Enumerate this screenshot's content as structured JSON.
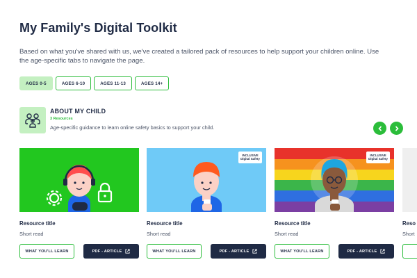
{
  "page": {
    "title": "My Family's Digital Toolkit",
    "intro": "Based on what you've shared with us, we've created a tailored pack of resources to help support your children online. Use the age-specific tabs to navigate the page."
  },
  "tabs": [
    {
      "label": "AGES 0-5"
    },
    {
      "label": "AGES 6-10"
    },
    {
      "label": "AGES 11-13"
    },
    {
      "label": "AGES 14+"
    }
  ],
  "section": {
    "title": "ABOUT MY CHILD",
    "count": "3 Resources",
    "description": "Age-specific guidance to learn online safety basics to support your child.",
    "icon": "family-icon"
  },
  "cards": [
    {
      "title": "Resource title",
      "subtitle": "Short read",
      "learn_label": "WHAT YOU'LL LEARN",
      "pdf_label": "PDF - ARTICLE",
      "badge": ""
    },
    {
      "title": "Resource title",
      "subtitle": "Short read",
      "learn_label": "WHAT YOU'LL LEARN",
      "pdf_label": "PDF - ARTICLE",
      "badge": "INCLUSIVE Digital Safety"
    },
    {
      "title": "Resource title",
      "subtitle": "Short read",
      "learn_label": "WHAT YOU'LL LEARN",
      "pdf_label": "PDF - ARTICLE",
      "badge": "INCLUSIVE Digital Safety"
    },
    {
      "title": "Reso",
      "subtitle": "Short",
      "learn_label": "",
      "pdf_label": "",
      "badge": ""
    }
  ],
  "colors": {
    "accent": "#2bbd3a",
    "accent_light": "#c4f0c1",
    "dark": "#1f2a44",
    "card1_bg": "#22c71f",
    "card2_bg": "#6fcaf7",
    "card3_bg": "rainbow"
  }
}
